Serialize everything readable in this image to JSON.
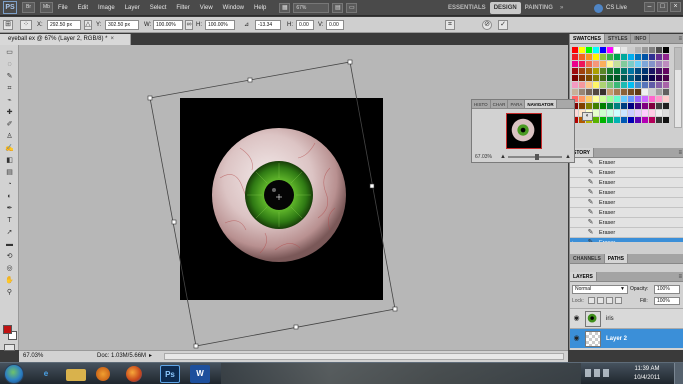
{
  "app": {
    "logo": "PS",
    "menus": [
      "File",
      "Edit",
      "Image",
      "Layer",
      "Select",
      "Filter",
      "View",
      "Window",
      "Help"
    ],
    "zoom_select": "67%",
    "workspaces": [
      "ESSENTIALS",
      "DESIGN",
      "PAINTING"
    ],
    "active_workspace": "DESIGN",
    "workspace_more": "»",
    "cs_live": "CS Live",
    "window_buttons": [
      "–",
      "□",
      "×"
    ]
  },
  "options_bar": {
    "x_label": "X:",
    "x_value": "292.50 px",
    "y_label": "Y:",
    "y_value": "302.50 px",
    "w_label": "W:",
    "w_value": "100.00%",
    "h_label": "H:",
    "h_value": "100.00%",
    "angle_label": "⊿",
    "angle_value": "-13.34",
    "hskew_label": "H:",
    "hskew_value": "0.00",
    "vskew_label": "V:",
    "vskew_value": "0.00",
    "cancel_symbol": "⊘",
    "commit_symbol": "✓"
  },
  "document": {
    "tab_title": "eyeball ex @ 67% (Layer 2, RGB/8) *",
    "tab_close": "×",
    "status_zoom": "67.03%",
    "status_doc": "Doc: 1.03M/5.66M",
    "status_arrow": "▸"
  },
  "navigator": {
    "tabs": [
      "HISTO",
      "CHAR",
      "PARA",
      "NAVIGATOR"
    ],
    "active_tab": "NAVIGATOR",
    "zoom": "67.03%",
    "minus": "▲",
    "plus": "▲"
  },
  "panels": {
    "swatch_tabs": [
      "SWATCHES",
      "STYLES",
      "INFO"
    ],
    "history_tab": "STORY",
    "history_items": [
      "Eraser",
      "Eraser",
      "Eraser",
      "Eraser",
      "Eraser",
      "Eraser",
      "Eraser",
      "Eraser",
      "Eraser"
    ],
    "history_selected_index": 8,
    "channel_tabs": [
      "CHANNELS",
      "PATHS"
    ],
    "layers_tab": "LAYERS",
    "blend_mode": "Normal",
    "opacity_label": "Opacity:",
    "opacity_value": "100%",
    "lock_label": "Lock:",
    "fill_label": "Fill:",
    "fill_value": "100%",
    "layers": [
      {
        "name": "iris",
        "selected": false
      },
      {
        "name": "Layer 2",
        "selected": true
      }
    ],
    "panel_menu": "≡"
  },
  "taskbar": {
    "apps": [
      "explorer",
      "internet-explorer",
      "windows-explorer",
      "media-player",
      "firefox",
      "photoshop",
      "word"
    ],
    "ps_label": "Ps",
    "word_label": "W",
    "time": "11:39 AM",
    "date": "10/4/2011"
  },
  "colors": {
    "foreground": "#c01212",
    "background": "#ffffff",
    "accent": "#3b8fd8",
    "iris": "#3f9a1f",
    "canvas_bg": "#b7b7b7"
  },
  "swatches": [
    [
      "#ff0000",
      "#ffff00",
      "#00ff00",
      "#00ffff",
      "#0000ff",
      "#ff00ff",
      "#ffffff",
      "#e6e6e6",
      "#cccccc",
      "#b3b3b3",
      "#999999",
      "#808080",
      "#4d4d4d",
      "#000000"
    ],
    [
      "#ed1c24",
      "#f26522",
      "#f7941d",
      "#fff200",
      "#8dc63f",
      "#39b54a",
      "#00a651",
      "#00a99d",
      "#00aeef",
      "#0072bc",
      "#0054a6",
      "#2e3192",
      "#662d91",
      "#92278f"
    ],
    [
      "#ec008c",
      "#ed145b",
      "#f26c4f",
      "#f69679",
      "#fbaf5d",
      "#fff799",
      "#c4df9b",
      "#82ca9c",
      "#7accc8",
      "#6dcff6",
      "#7da7d9",
      "#8393ca",
      "#a186be",
      "#bd8cbf"
    ],
    [
      "#9e0b0f",
      "#a0410d",
      "#a36209",
      "#aba000",
      "#598527",
      "#1a7b30",
      "#007236",
      "#00746b",
      "#0076a3",
      "#004a80",
      "#003471",
      "#1b1464",
      "#440e62",
      "#630460"
    ],
    [
      "#790000",
      "#7b2e00",
      "#7d4900",
      "#827b00",
      "#406618",
      "#005e20",
      "#005826",
      "#005952",
      "#005b7f",
      "#003663",
      "#002157",
      "#0d004c",
      "#32004b",
      "#4b0049"
    ],
    [
      "#f49ac1",
      "#f5989d",
      "#fdc689",
      "#fff568",
      "#acd373",
      "#7cc576",
      "#3cb878",
      "#1cbbb4",
      "#00bff3",
      "#448ccb",
      "#5674b9",
      "#605ca8",
      "#855fa8",
      "#a864a8"
    ],
    [
      "#c7b299",
      "#998675",
      "#736357",
      "#534741",
      "#37302d",
      "#c69c6d",
      "#a67c52",
      "#8c6239",
      "#754c24",
      "#603913",
      "#f0f0f0",
      "#d0d0d0",
      "#a0a0a0",
      "#606060"
    ],
    [
      "#ff6666",
      "#ff9966",
      "#ffcc66",
      "#ffff99",
      "#ccff99",
      "#99ff99",
      "#66ffcc",
      "#66ccff",
      "#6699ff",
      "#9966ff",
      "#cc66ff",
      "#ff66cc",
      "#ff99cc",
      "#ffcccc"
    ],
    [
      "#800000",
      "#804000",
      "#808000",
      "#408000",
      "#008000",
      "#008040",
      "#008080",
      "#004080",
      "#000080",
      "#400080",
      "#800080",
      "#800040",
      "#404040",
      "#202020"
    ],
    [
      "#ffd9d9",
      "#ffe6cc",
      "#ffffcc",
      "#e6ffcc",
      "#ccffcc",
      "#ccffe6",
      "#ccffff",
      "#cce6ff",
      "#ccccff",
      "#e6ccff",
      "#ffccff",
      "#ffcce6",
      "#eeeeee",
      "#dddddd"
    ],
    [
      "#b30000",
      "#b35900",
      "#b3b300",
      "#59b300",
      "#00b300",
      "#00b359",
      "#00b3b3",
      "#0059b3",
      "#0000b3",
      "#5900b3",
      "#b300b3",
      "#b30059",
      "#333333",
      "#111111"
    ]
  ]
}
